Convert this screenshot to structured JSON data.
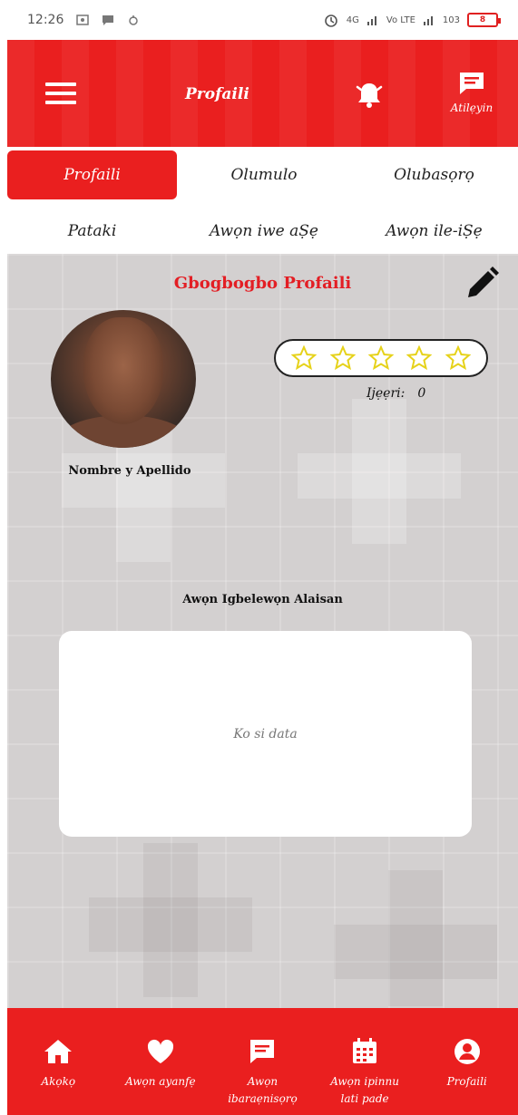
{
  "status_bar": {
    "time": "12:26",
    "network_1": "4G",
    "network_2": "Vo LTE",
    "speed": "103",
    "battery": "8"
  },
  "header": {
    "title": "Profaili",
    "help_label": "Atilẹyin"
  },
  "tabs": {
    "profile": "Profaili",
    "users": "Olumulo",
    "contact": "Olubasọrọ",
    "pataki": "Pataki",
    "documents": "Awọn iwe aṢẹ",
    "workplaces": "Awọn ile-iṢẹ"
  },
  "profile": {
    "section_title": "Gbogbogbo Profaili",
    "user_name": "Nombre y Apellido",
    "rating_stars": 0,
    "reviews_label": "Ijẹẹri:",
    "reviews_count": "0",
    "ratings_title": "Awọn Igbelewọn Alaisan",
    "empty_text": "Ko si data"
  },
  "bottom_nav": {
    "home": "Akọkọ",
    "favorites": "Awọn ayanfẹ",
    "chats_line1": "Awọn",
    "chats_line2": "ibaraẹnisọrọ",
    "appointments_line1": "Awọn ipinnu",
    "appointments_line2": "lati pade",
    "profile": "Profaili"
  },
  "colors": {
    "primary": "#ea1f1f",
    "section_title": "#e31e24",
    "star": "#e6d21a",
    "background": "#d3d0d0"
  }
}
